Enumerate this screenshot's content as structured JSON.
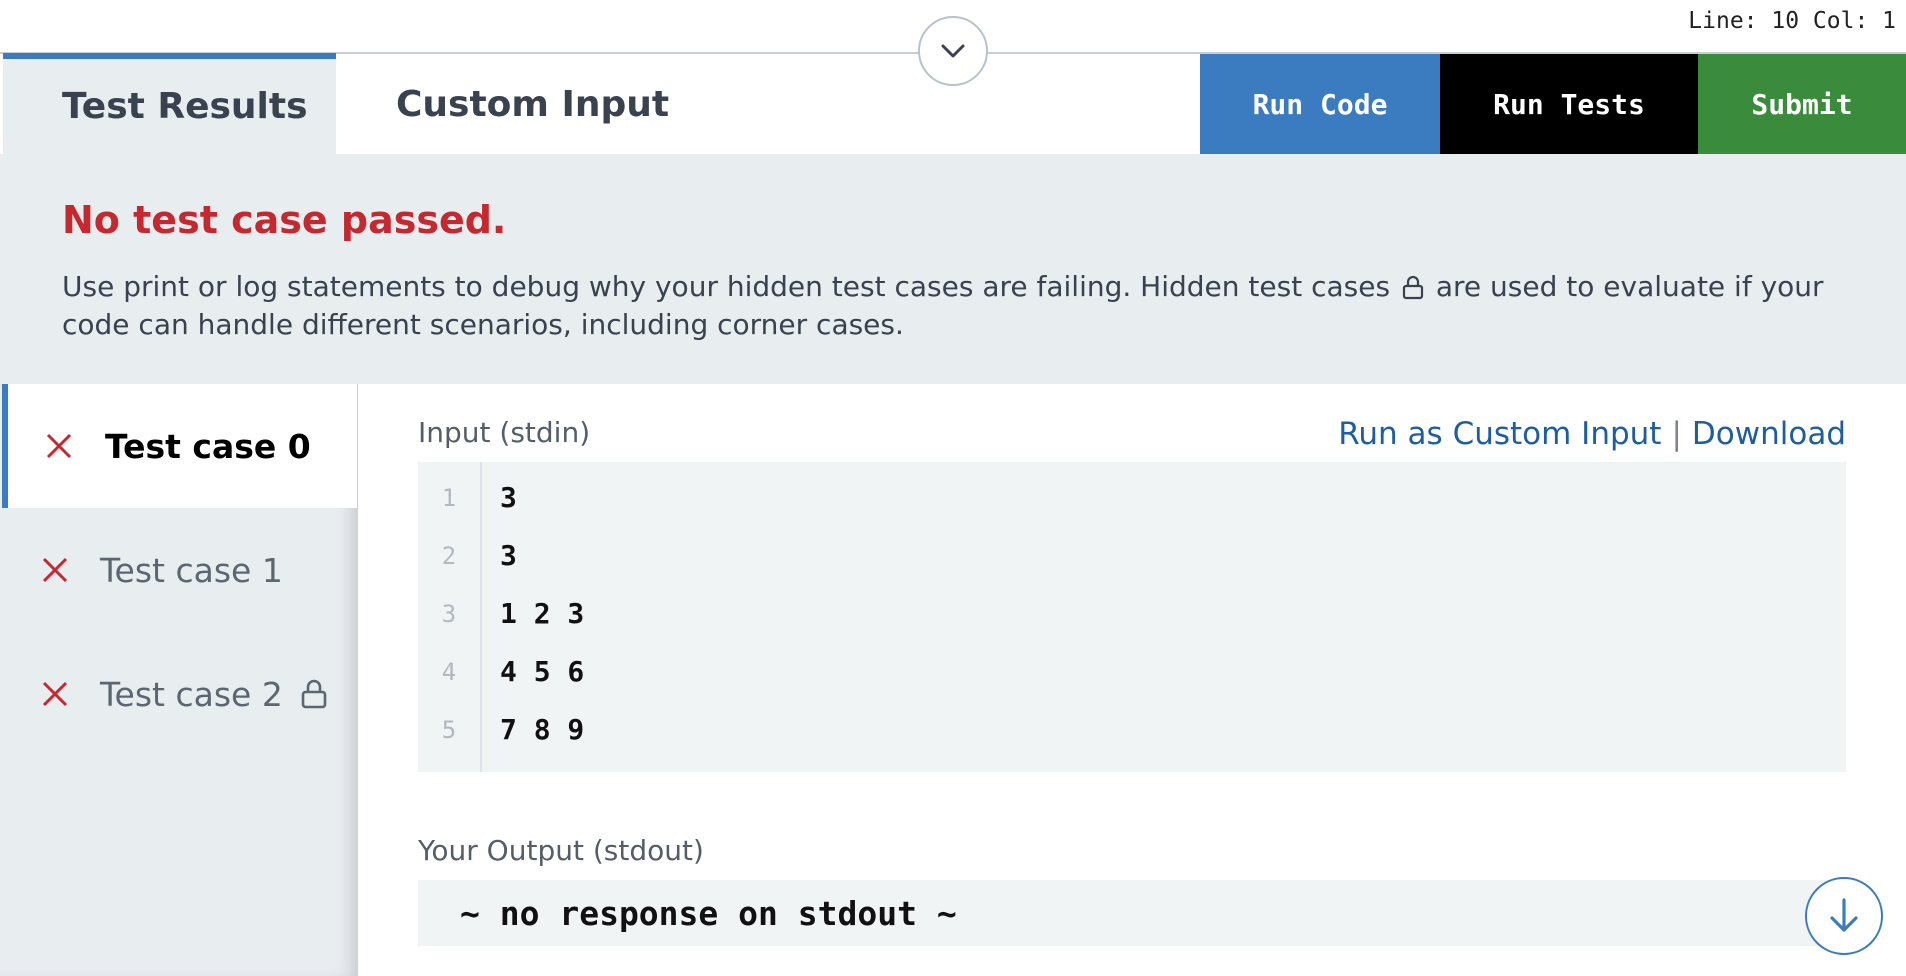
{
  "editor_status": {
    "cursor_position": "Line: 10 Col: 1"
  },
  "tabs": [
    {
      "label": "Test Results",
      "active": true
    },
    {
      "label": "Custom Input",
      "active": false
    }
  ],
  "actions": {
    "run_code": "Run Code",
    "run_tests": "Run Tests",
    "submit": "Submit"
  },
  "summary": {
    "title": "No test case passed.",
    "text_before_icon": "Use print or log statements to debug why your hidden test cases are failing. Hidden test cases",
    "text_after_icon": "are used to evaluate if your code can handle different scenarios, including corner cases."
  },
  "test_cases": [
    {
      "label": "Test case 0",
      "status": "failed",
      "locked": false,
      "active": true
    },
    {
      "label": "Test case 1",
      "status": "failed",
      "locked": false,
      "active": false
    },
    {
      "label": "Test case 2",
      "status": "failed",
      "locked": true,
      "active": false
    }
  ],
  "input": {
    "label": "Input (stdin)",
    "links": {
      "run_as_custom": "Run as Custom Input",
      "separator": "|",
      "download": "Download"
    },
    "lines": [
      {
        "num": "1",
        "text": "3"
      },
      {
        "num": "2",
        "text": "3"
      },
      {
        "num": "3",
        "text": "1 2 3"
      },
      {
        "num": "4",
        "text": "4 5 6"
      },
      {
        "num": "5",
        "text": "7 8 9"
      }
    ]
  },
  "output": {
    "label": "Your Output (stdout)",
    "text": "~ no response on stdout ~"
  },
  "colors": {
    "accent_blue": "#3a7cbf",
    "submit_green": "#3a8b3c",
    "error_red": "#c5282f",
    "panel_gray": "#e8edf0"
  },
  "icons": {
    "collapse": "chevron-down-icon",
    "fail": "x-icon",
    "lock": "lock-icon",
    "scroll": "arrow-down-icon"
  }
}
